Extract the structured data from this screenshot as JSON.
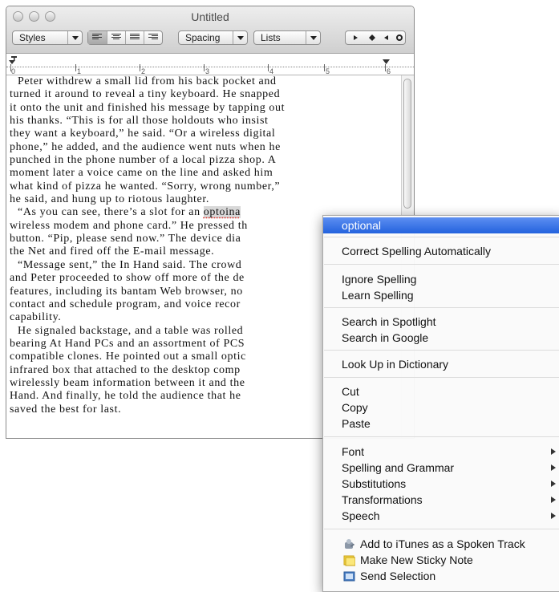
{
  "window": {
    "title": "Untitled"
  },
  "toolbar": {
    "styles_label": "Styles",
    "spacing_label": "Spacing",
    "lists_label": "Lists"
  },
  "ruler": {
    "marks": [
      "0",
      "1",
      "2",
      "3",
      "4",
      "5",
      "6"
    ]
  },
  "document": {
    "paragraphs": [
      [
        "Peter withdrew a small lid from his back pocket and",
        "turned it around to reveal a tiny keyboard. He snapped",
        "it onto the unit and finished his message by tapping out",
        "his thanks. “This is for all those holdouts who insist",
        "they want a keyboard,” he said. “Or a wireless digital",
        "phone,” he added, and the audience went nuts when he",
        "punched in the phone number of a local pizza shop. A",
        "moment later a voice came on the line and asked him",
        "what kind of pizza he wanted. “Sorry, wrong number,”",
        "he said, and hung up to riotous laughter."
      ],
      [
        "“As you can see, there’s a slot for an ",
        "wireless modem and phone card.” He pressed th",
        "button. “Pip, please send now.” The device dia",
        "the Net and fired off the E-mail message."
      ],
      [
        "“Message sent,” the In Hand said. The crowd",
        "and Peter proceeded to show off more of the de",
        "features, including its bantam Web browser, no",
        "contact and schedule program, and voice recor",
        "capability."
      ],
      [
        "He signaled backstage, and a table was rolled",
        "bearing At Hand PCs and an assortment of PCS",
        "compatible clones. He pointed out a small optic",
        "infrared box that attached to the desktop comp",
        "wirelessly beam information between it and the",
        "Hand. And finally, he told the audience that he",
        "saved the best for last."
      ]
    ],
    "misspelled_word": "optoina"
  },
  "context_menu": {
    "suggestion": "optional",
    "correct_auto": "Correct Spelling Automatically",
    "ignore_spelling": "Ignore Spelling",
    "learn_spelling": "Learn Spelling",
    "search_spotlight": "Search in Spotlight",
    "search_google": "Search in Google",
    "look_up": "Look Up in Dictionary",
    "cut": "Cut",
    "copy": "Copy",
    "paste": "Paste",
    "font": "Font",
    "spelling_grammar": "Spelling and Grammar",
    "substitutions": "Substitutions",
    "transformations": "Transformations",
    "speech": "Speech",
    "add_itunes": "Add to iTunes as a Spoken Track",
    "sticky_note": "Make New Sticky Note",
    "send_selection": "Send Selection"
  },
  "colors": {
    "highlight": "#2f6ce4",
    "misspell_underline": "#e0332b"
  }
}
